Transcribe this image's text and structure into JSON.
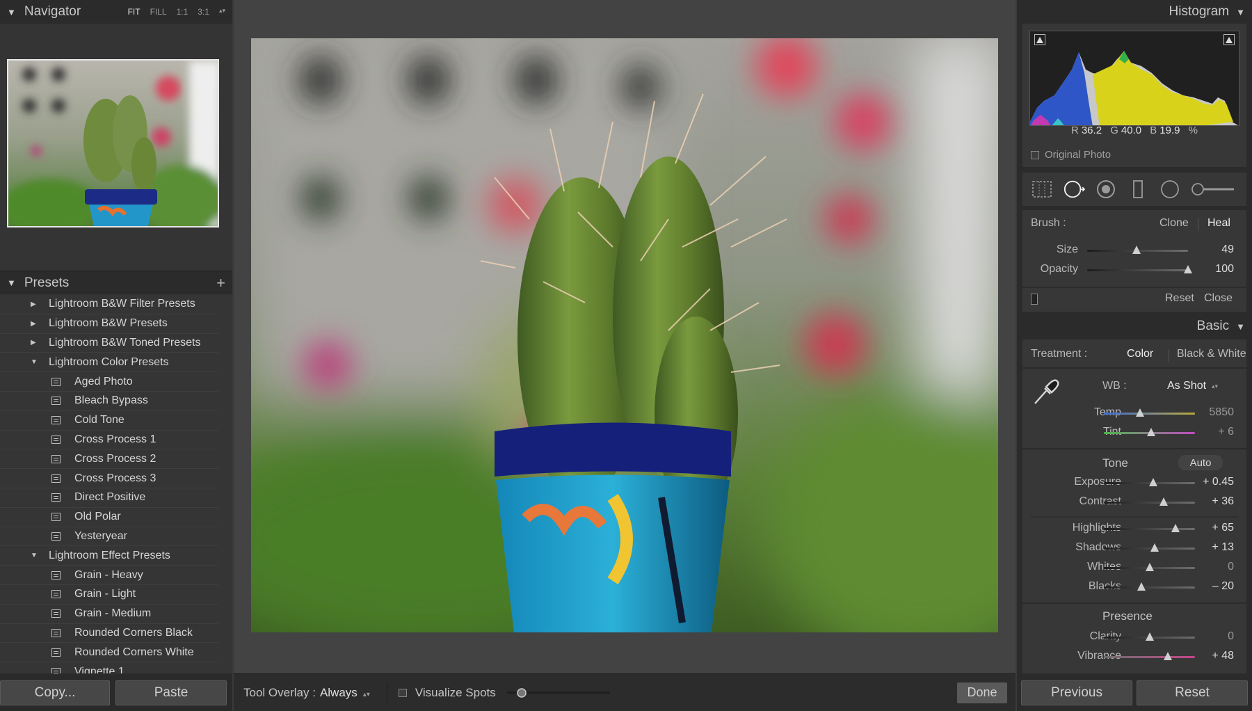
{
  "navigator": {
    "title": "Navigator",
    "zoom_options": [
      "FIT",
      "FILL",
      "1:1",
      "3:1"
    ],
    "active_zoom": "FIT"
  },
  "presets": {
    "title": "Presets",
    "rows": [
      {
        "type": "folder",
        "expanded": false,
        "label": "Lightroom B&W Filter Presets"
      },
      {
        "type": "folder",
        "expanded": false,
        "label": "Lightroom B&W Presets"
      },
      {
        "type": "folder",
        "expanded": false,
        "label": "Lightroom B&W Toned Presets"
      },
      {
        "type": "folder",
        "expanded": true,
        "label": "Lightroom Color Presets"
      },
      {
        "type": "item",
        "label": "Aged Photo"
      },
      {
        "type": "item",
        "label": "Bleach Bypass"
      },
      {
        "type": "item",
        "label": "Cold Tone"
      },
      {
        "type": "item",
        "label": "Cross Process 1"
      },
      {
        "type": "item",
        "label": "Cross Process 2"
      },
      {
        "type": "item",
        "label": "Cross Process 3"
      },
      {
        "type": "item",
        "label": "Direct Positive"
      },
      {
        "type": "item",
        "label": "Old Polar"
      },
      {
        "type": "item",
        "label": "Yesteryear"
      },
      {
        "type": "folder",
        "expanded": true,
        "label": "Lightroom Effect Presets"
      },
      {
        "type": "item",
        "label": "Grain - Heavy"
      },
      {
        "type": "item",
        "label": "Grain - Light"
      },
      {
        "type": "item",
        "label": "Grain - Medium"
      },
      {
        "type": "item",
        "label": "Rounded Corners Black"
      },
      {
        "type": "item",
        "label": "Rounded Corners White"
      },
      {
        "type": "item",
        "label": "Vignette 1"
      }
    ]
  },
  "left_buttons": {
    "copy": "Copy...",
    "paste": "Paste"
  },
  "toolbar": {
    "tool_overlay_label": "Tool Overlay :",
    "tool_overlay_value": "Always",
    "visualize_spots": "Visualize Spots",
    "visualize_level": 0.1,
    "done": "Done"
  },
  "histogram": {
    "title": "Histogram",
    "r_label": "R",
    "r_value": "36.2",
    "g_label": "G",
    "g_value": "40.0",
    "b_label": "B",
    "b_value": "19.9",
    "unit": "%",
    "original_photo": "Original Photo"
  },
  "brush": {
    "label": "Brush :",
    "clone": "Clone",
    "heal": "Heal",
    "size_label": "Size",
    "size_value": "49",
    "size_level": 0.49,
    "opacity_label": "Opacity",
    "opacity_value": "100",
    "opacity_level": 1.0,
    "reset": "Reset",
    "close": "Close"
  },
  "basic": {
    "title": "Basic",
    "treatment_label": "Treatment :",
    "color": "Color",
    "bw": "Black & White",
    "wb_label": "WB :",
    "wb_value": "As Shot",
    "temp_label": "Temp",
    "temp_value": "5850",
    "temp_level": 0.4,
    "tint_label": "Tint",
    "tint_value": "+ 6",
    "tint_level": 0.52,
    "tone_title": "Tone",
    "auto": "Auto",
    "exposure_label": "Exposure",
    "exposure_value": "+ 0.45",
    "exposure_level": 0.54,
    "contrast_label": "Contrast",
    "contrast_value": "+ 36",
    "contrast_level": 0.66,
    "highlights_label": "Highlights",
    "highlights_value": "+ 65",
    "highlights_level": 0.79,
    "shadows_label": "Shadows",
    "shadows_value": "+ 13",
    "shadows_level": 0.56,
    "whites_label": "Whites",
    "whites_value": "0",
    "whites_level": 0.5,
    "blacks_label": "Blacks",
    "blacks_value": "– 20",
    "blacks_level": 0.41,
    "presence_title": "Presence",
    "clarity_label": "Clarity",
    "clarity_value": "0",
    "clarity_level": 0.5,
    "vibrance_label": "Vibrance",
    "vibrance_value": "+ 48",
    "vibrance_level": 0.7
  },
  "right_buttons": {
    "previous": "Previous",
    "reset": "Reset"
  }
}
